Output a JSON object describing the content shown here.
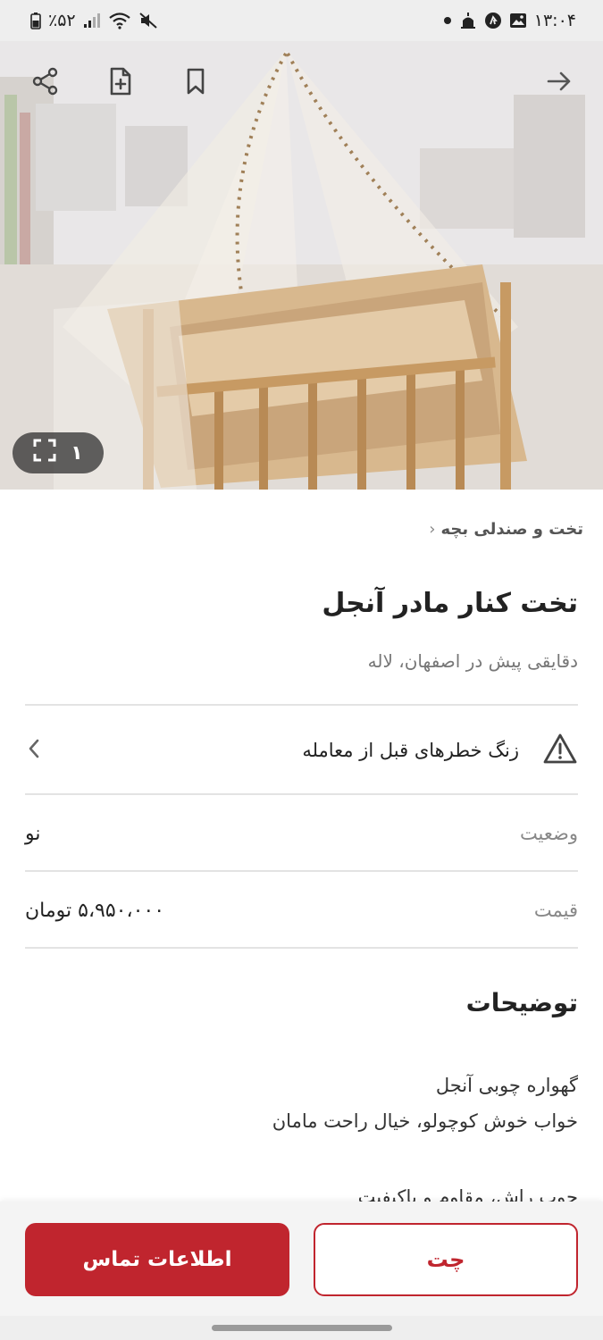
{
  "status_bar": {
    "time": "۱۳:۰۴",
    "battery": "٪۵۲",
    "icons": [
      "dot-icon",
      "mosque-icon",
      "fastlane-icon",
      "gallery-icon",
      "mute-icon",
      "wifi-icon",
      "signal-icon",
      "battery-icon"
    ]
  },
  "hero": {
    "image_count": "۱",
    "icons": [
      "back-arrow-icon",
      "bookmark-icon",
      "note-add-icon",
      "share-icon",
      "fullscreen-icon"
    ]
  },
  "listing": {
    "breadcrumb": "تخت و صندلی بچه",
    "title": "تخت کنار مادر آنجل",
    "subtitle": "دقایقی پیش در اصفهان، لاله",
    "warning": "زنگ خطرهای قبل از معامله",
    "fields": [
      {
        "label": "وضعیت",
        "value": "نو"
      },
      {
        "label": "قیمت",
        "value": "۵،۹۵۰،۰۰۰ تومان"
      }
    ],
    "description_title": "توضیحات",
    "description_lines": [
      "گهواره چوبی آنجل",
      "خواب خوش کوچولو، خیال راحت مامان",
      "چوب راش، مقاوم و باکیفیت"
    ]
  },
  "actions": {
    "chat_label": "چت",
    "contact_label": "اطلاعات تماس"
  },
  "colors": {
    "accent": "#c0252e",
    "status_bar_bg": "#eeeeee"
  }
}
